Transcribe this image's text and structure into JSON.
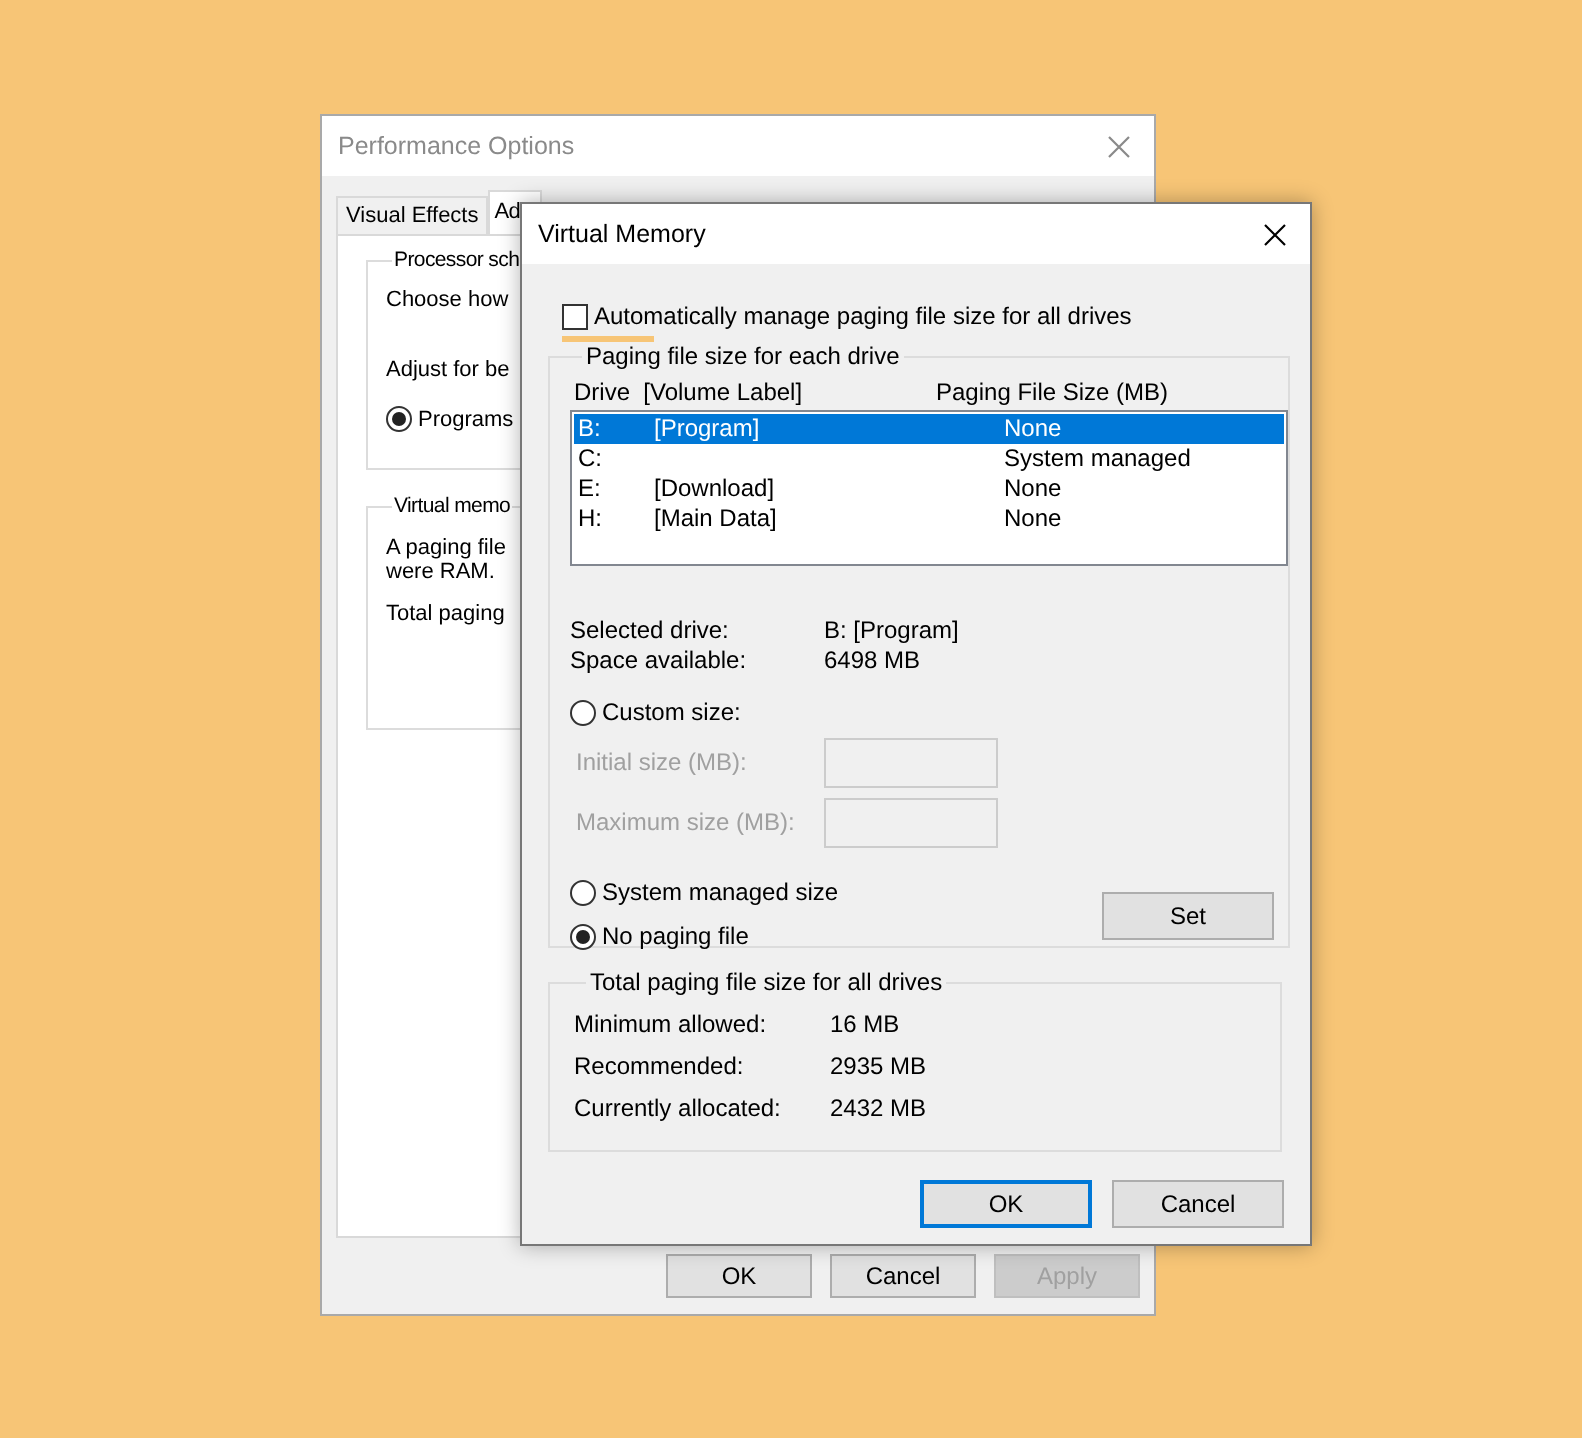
{
  "background_window": {
    "title": "Performance Options",
    "tabs": [
      {
        "label": "Visual Effects",
        "selected": false
      },
      {
        "label": "Ad",
        "selected": true
      }
    ],
    "groups": [
      {
        "title": "Processor sch",
        "items": [
          {
            "kind": "text",
            "text": "Choose how"
          },
          {
            "kind": "text",
            "text": "Adjust for be"
          },
          {
            "kind": "radio",
            "label": "Programs",
            "selected": true
          }
        ]
      },
      {
        "title": "Virtual memo",
        "items": [
          {
            "kind": "text",
            "text": "A paging file"
          },
          {
            "kind": "text",
            "text": "were RAM."
          },
          {
            "kind": "text",
            "text": "Total paging"
          }
        ]
      }
    ],
    "buttons": [
      {
        "label": "OK",
        "disabled": false
      },
      {
        "label": "Cancel",
        "disabled": false
      },
      {
        "label": "Apply",
        "disabled": true
      }
    ]
  },
  "dialog": {
    "title": "Virtual Memory",
    "auto_manage": {
      "label": "Automatically manage paging file size for all drives",
      "checked": false
    },
    "drives_group": {
      "title": "Paging file size for each drive",
      "columns": [
        "Drive  [Volume Label]",
        "Paging File Size (MB)"
      ],
      "rows": [
        {
          "drive": "B:",
          "volume": "[Program]",
          "size": "None",
          "selected": true
        },
        {
          "drive": "C:",
          "size": "System managed",
          "selected": false
        },
        {
          "drive": "E:",
          "volume": "[Download]",
          "size": "None",
          "selected": false
        },
        {
          "drive": "H:",
          "volume": "[Main Data]",
          "size": "None",
          "selected": false
        }
      ],
      "info": [
        {
          "label": "Selected drive:",
          "value": "B:  [Program]"
        },
        {
          "label": "Space available:",
          "value": "6498 MB"
        }
      ],
      "options": [
        {
          "kind": "radio",
          "label": "Custom size:",
          "selected": false
        },
        {
          "kind": "field",
          "label": "Initial size (MB):",
          "disabled": true
        },
        {
          "kind": "field",
          "label": "Maximum size (MB):",
          "disabled": true
        },
        {
          "kind": "radio",
          "label": "System managed size",
          "selected": false
        },
        {
          "kind": "radio",
          "label": "No paging file",
          "selected": true
        }
      ],
      "set_button": "Set"
    },
    "totals_group": {
      "title": "Total paging file size for all drives",
      "rows": [
        {
          "label": "Minimum allowed:",
          "value": "16 MB"
        },
        {
          "label": "Recommended:",
          "value": "2935 MB"
        },
        {
          "label": "Currently allocated:",
          "value": "2432 MB"
        }
      ]
    },
    "buttons": [
      {
        "label": "OK",
        "focused": true
      },
      {
        "label": "Cancel",
        "focused": false
      }
    ]
  }
}
